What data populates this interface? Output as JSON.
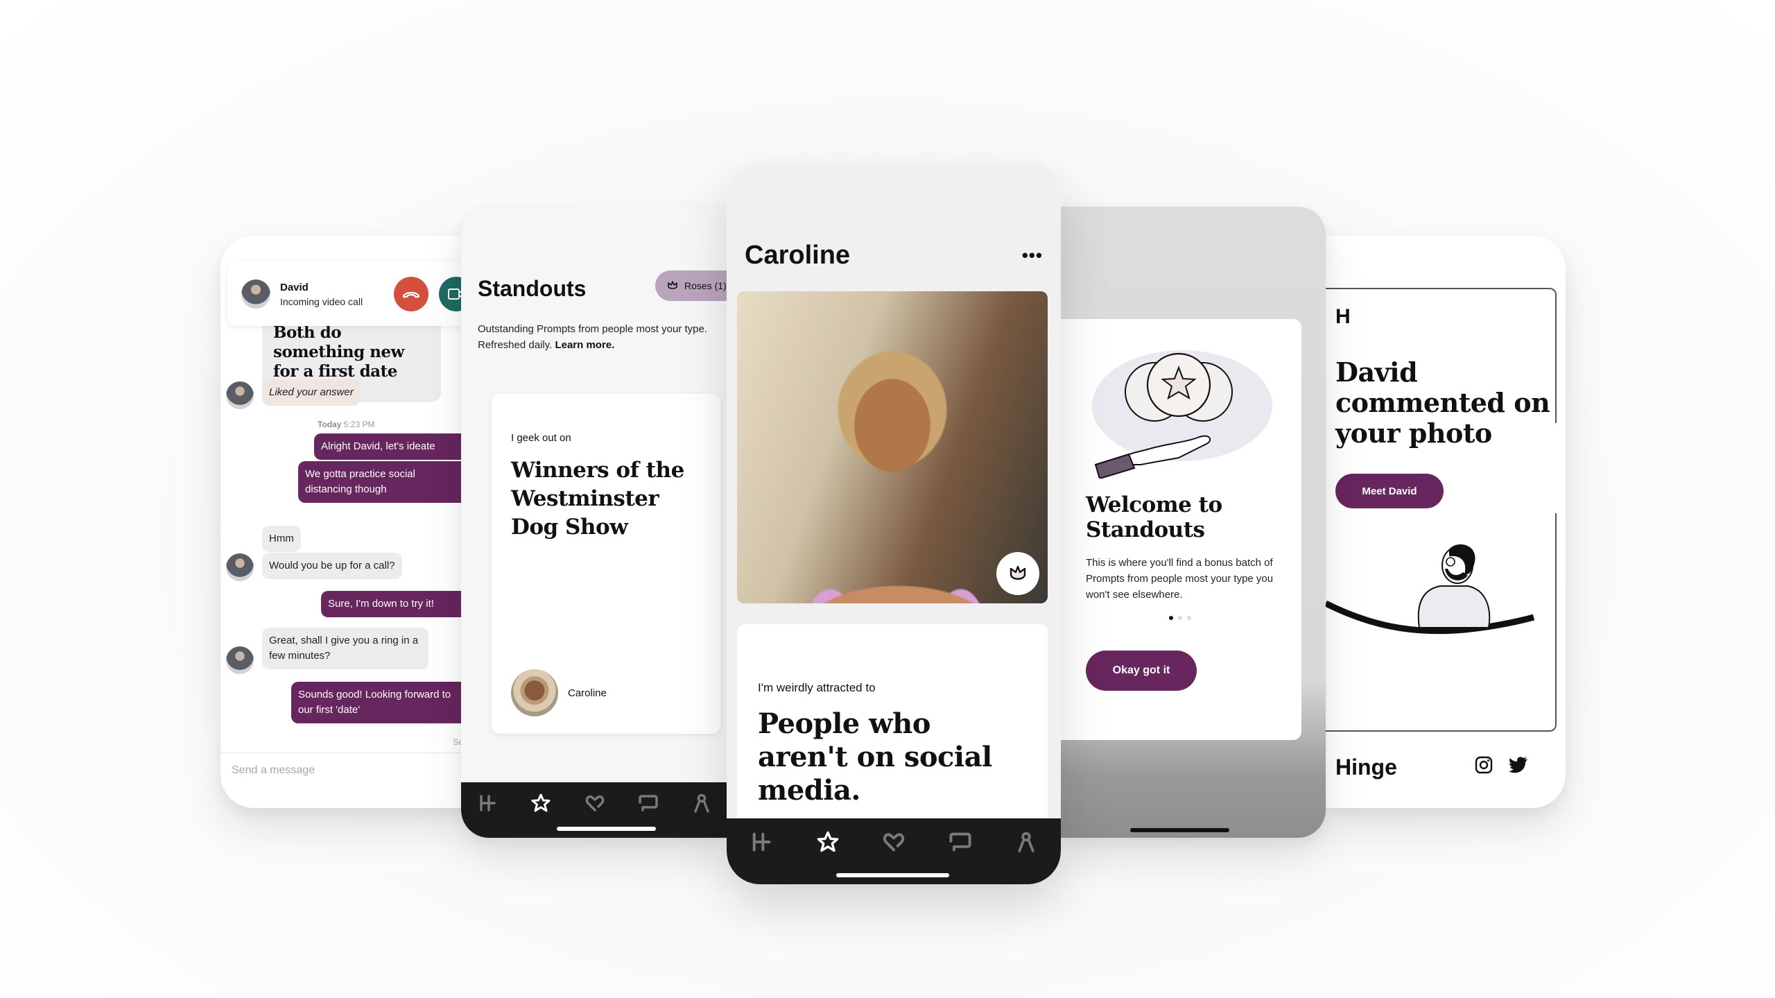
{
  "colors": {
    "brand_purple": "#67265e",
    "roses_pill": "#baa4bc",
    "decline_red": "#d4503d",
    "video_green": "#1e6b63",
    "tabbar_bg": "#1b1b1b"
  },
  "chat": {
    "incoming_call": {
      "name": "David",
      "status": "Incoming video call",
      "decline_icon": "phone-hangup-icon",
      "accept_icon": "video-camera-icon"
    },
    "quoted_prompt_answer": "Both do something new for a first date",
    "liked_label": "Liked your answer",
    "timestamp_day": "Today",
    "timestamp_time": "5:23 PM",
    "messages": [
      {
        "from": "me",
        "text": "Alright David, let's ideate"
      },
      {
        "from": "me",
        "text": "We gotta practice social distancing though"
      },
      {
        "from": "them",
        "text": "Hmm"
      },
      {
        "from": "them",
        "text": "Would you be up for a call?"
      },
      {
        "from": "me",
        "text": "Sure, I'm down to try it!"
      },
      {
        "from": "them",
        "text": "Great, shall I give you a ring in a few minutes?"
      },
      {
        "from": "me",
        "text": "Sounds good! Looking forward to our first 'date'"
      }
    ],
    "sent_label": "Sent",
    "composer_placeholder": "Send a message"
  },
  "standouts": {
    "title": "Standouts",
    "roses_label": "Roses (1)",
    "subtitle": "Outstanding Prompts from people most your type. Refreshed daily.",
    "learn_more": "Learn more.",
    "card": {
      "prompt": "I geek out on",
      "answer": "Winners of the Westminster Dog Show",
      "person_name": "Caroline"
    },
    "tabs": [
      "home-icon",
      "standouts-star-icon",
      "likes-heart-icon",
      "chat-bubble-icon",
      "profile-icon"
    ],
    "active_tab": 1
  },
  "profile": {
    "name": "Caroline",
    "more_label": "•••",
    "photo_alt": "Smiling woman with braided hair",
    "rose_button_icon": "rose-icon",
    "prompt": "I'm weirdly attracted to",
    "answer": "People who aren't on social media.",
    "tabs": [
      "home-icon",
      "standouts-star-icon",
      "likes-heart-icon",
      "chat-bubble-icon",
      "profile-icon"
    ],
    "active_tab": 1
  },
  "welcome": {
    "heading": "Welcome to Standouts",
    "body": "This is where you'll find a bonus batch of Prompts from people most your type you won't see elsewhere.",
    "page_index": 1,
    "page_count": 3,
    "button_label": "Okay got it"
  },
  "notification": {
    "logo_mark": "H",
    "heading": "David commented on your photo",
    "button_label": "Meet David",
    "brand_name": "Hinge",
    "social_icons": [
      "instagram-icon",
      "twitter-icon"
    ]
  }
}
